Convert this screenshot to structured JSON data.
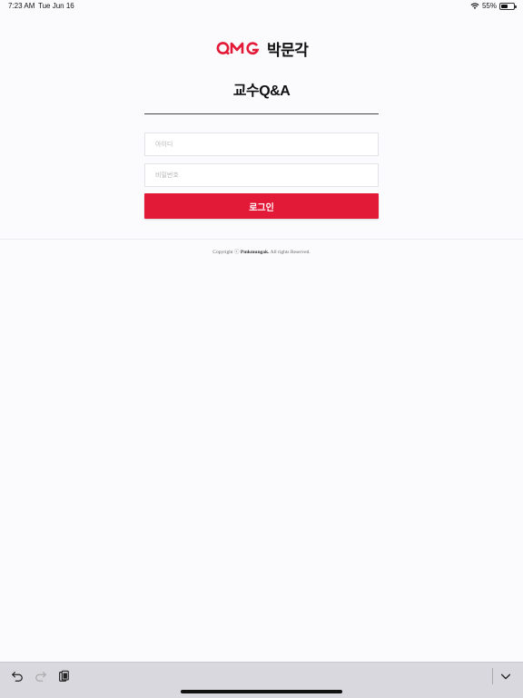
{
  "status": {
    "time": "7:23 AM",
    "date": "Tue Jun 16",
    "battery": "55%",
    "battery_level": 0.55
  },
  "brand": {
    "logo_latin": "QMG",
    "logo_korean": "박문각",
    "accent_color": "#e31a37"
  },
  "page": {
    "title": "교수Q&A"
  },
  "form": {
    "id_placeholder": "아이디",
    "password_placeholder": "비밀번호",
    "login_label": "로그인"
  },
  "footer": {
    "copyright_prefix": "Copyright ⓒ",
    "company": "Pmkmungak.",
    "rights": "All rights Reserved."
  },
  "keyboard_toolbar": {
    "icons": [
      "undo-icon",
      "redo-icon",
      "paste-icon",
      "keyboard-dismiss-icon"
    ]
  }
}
